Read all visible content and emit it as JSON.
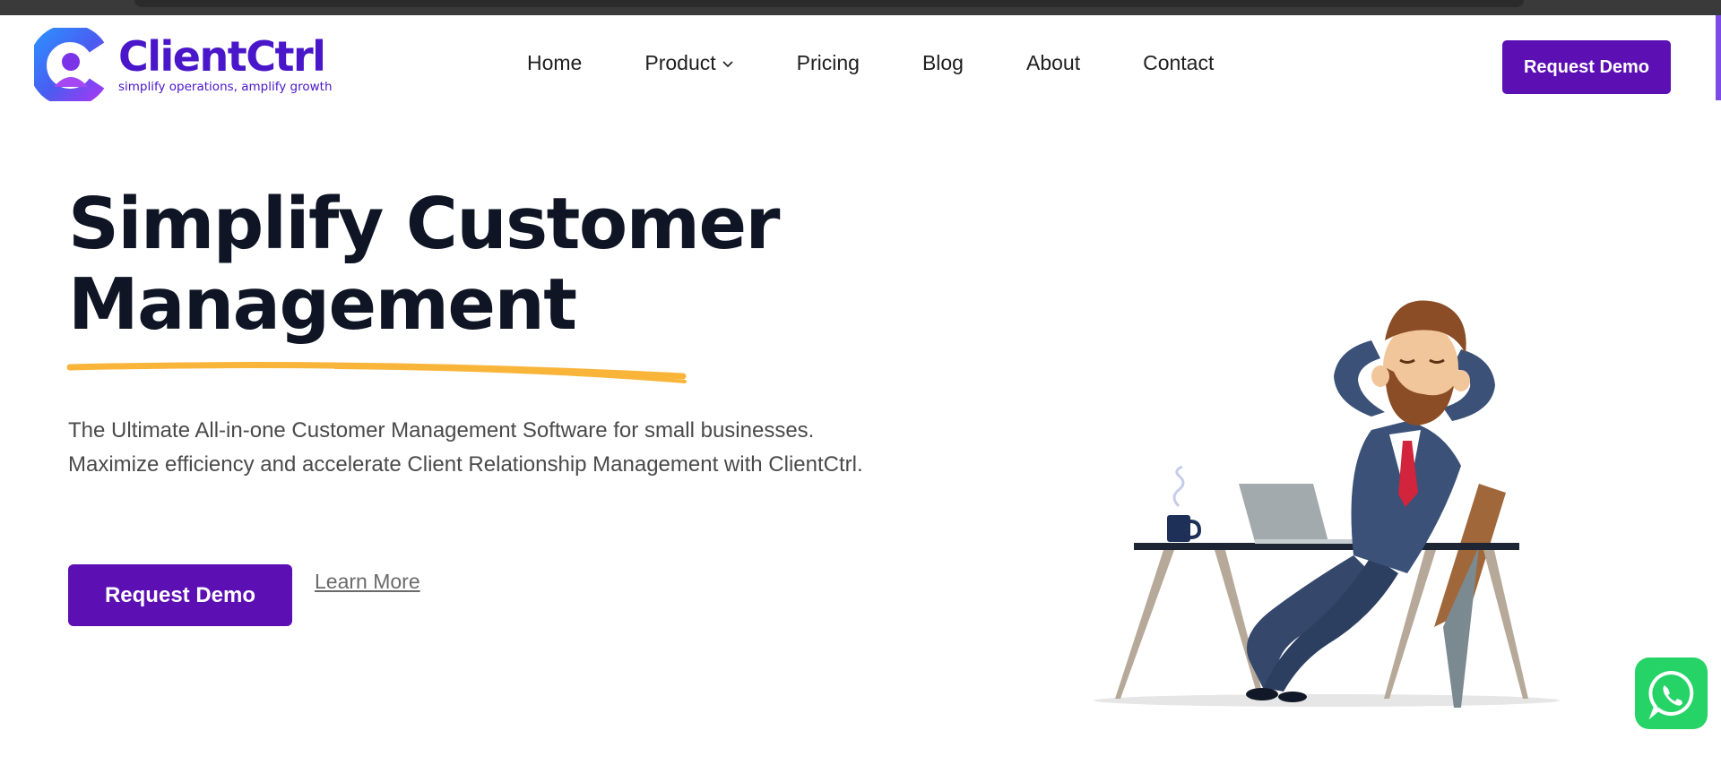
{
  "brand": {
    "name": "ClientCtrl",
    "tagline": "simplify operations, amplify growth",
    "colors": {
      "primary": "#5c0fb3",
      "logo_text": "#4a16c9",
      "accent_underline": "#f9b53a",
      "whatsapp": "#25d366"
    }
  },
  "nav": {
    "items": [
      {
        "label": "Home"
      },
      {
        "label": "Product",
        "icon": "chevron-down-icon"
      },
      {
        "label": "Pricing"
      },
      {
        "label": "Blog"
      },
      {
        "label": "About"
      },
      {
        "label": "Contact"
      }
    ],
    "cta_label": "Request Demo"
  },
  "hero": {
    "title_line1": "Simplify Customer",
    "title_line2": "Management",
    "subtitle_line1": "The Ultimate All-in-one Customer Management Software for small businesses.",
    "subtitle_line2": "Maximize efficiency and accelerate Client Relationship Management with ClientCtrl.",
    "cta_label": "Request Demo",
    "secondary_link": "Learn More",
    "illustration": "relaxed-businessman-at-desk"
  },
  "floating": {
    "whatsapp_icon": "whatsapp-icon"
  }
}
